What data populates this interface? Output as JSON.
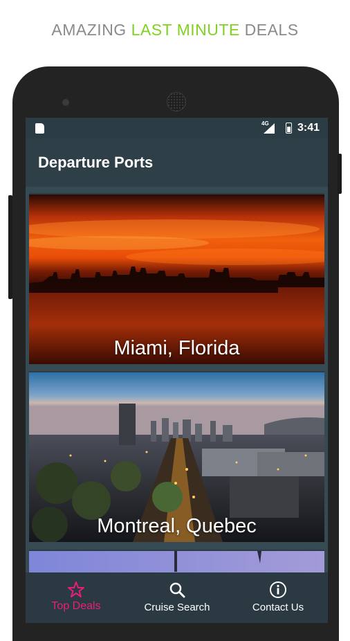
{
  "promo": {
    "part1": "AMAZING",
    "highlight": "LAST MINUTE",
    "part2": "DEALS"
  },
  "status_bar": {
    "network": "4G",
    "time": "3:41"
  },
  "app_bar": {
    "title": "Departure Ports"
  },
  "ports": [
    {
      "label": "Miami, Florida"
    },
    {
      "label": "Montreal, Quebec"
    },
    {
      "label": ""
    }
  ],
  "bottom_nav": {
    "items": [
      {
        "label": "Top Deals",
        "icon": "star-icon",
        "active": true
      },
      {
        "label": "Cruise Search",
        "icon": "search-icon",
        "active": false
      },
      {
        "label": "Contact Us",
        "icon": "info-icon",
        "active": false
      }
    ]
  },
  "colors": {
    "accent": "#e91e7a",
    "promo_highlight": "#7ed321",
    "app_bar": "#2e3f48",
    "screen_bg": "#364a54"
  }
}
